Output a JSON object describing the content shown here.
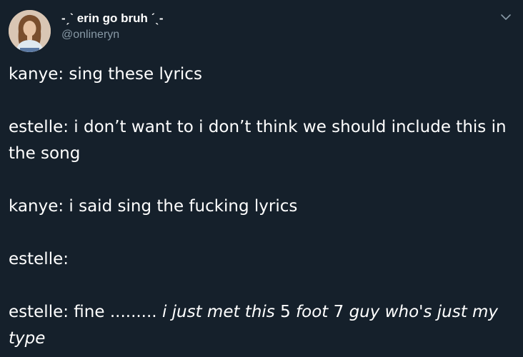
{
  "author": {
    "display_name": "-ˏˋ erin go bruh ˊˎ-",
    "handle": "@onlineryn",
    "avatar_icon": "profile-photo"
  },
  "menu_icon": "chevron-down-icon",
  "tweet": {
    "line_1": "kanye: sing these lyrics",
    "line_2": "estelle: i don’t want to i don’t think we should include this in the song",
    "line_3": "kanye: i said sing the fucking lyrics",
    "line_4": "estelle:",
    "line_5_prefix": "estelle: fine ......... ",
    "line_5_styled_a": "i just met this ",
    "line_5_styled_num_a": "5",
    "line_5_styled_b": " foot ",
    "line_5_styled_num_b": "7",
    "line_5_styled_c": " guy who's just my type"
  },
  "colors": {
    "background": "#15202b",
    "text": "#ffffff",
    "secondary_text": "#8899a6"
  }
}
